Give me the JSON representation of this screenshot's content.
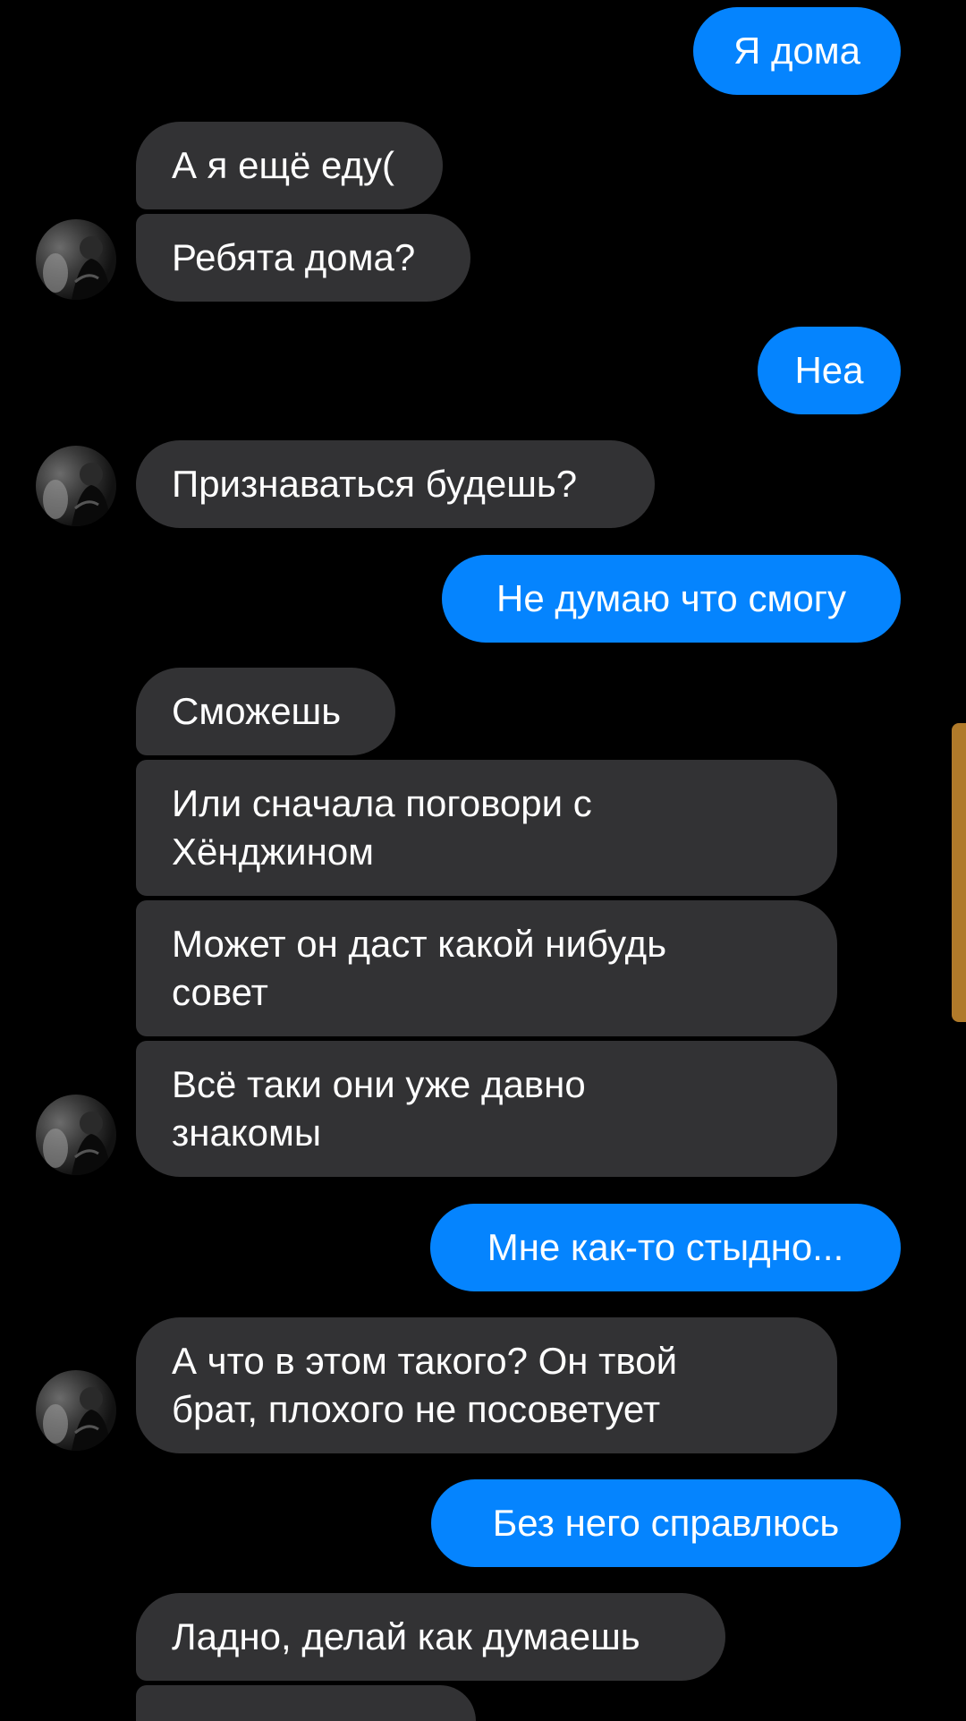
{
  "colors": {
    "background": "#000000",
    "incoming_bubble": "#323234",
    "outgoing_bubble": "#0584fe",
    "text": "#ffffff",
    "scroll_indicator": "#b07a2a"
  },
  "avatar_icon": "contact-photo",
  "messages": [
    {
      "direction": "out",
      "text": "Я дома"
    },
    {
      "direction": "in",
      "text": "А я ещё еду("
    },
    {
      "direction": "in",
      "text": "Ребята дома?"
    },
    {
      "direction": "out",
      "text": "Неа"
    },
    {
      "direction": "in",
      "text": "Признаваться будешь?"
    },
    {
      "direction": "out",
      "text": "Не думаю что смогу"
    },
    {
      "direction": "in",
      "text": "Сможешь"
    },
    {
      "direction": "in",
      "text": "Или сначала поговори с\nХёнджином"
    },
    {
      "direction": "in",
      "text": "Может он даст какой нибудь\nсовет"
    },
    {
      "direction": "in",
      "text": "Всё таки они уже давно\nзнакомы"
    },
    {
      "direction": "out",
      "text": "Мне как-то стыдно..."
    },
    {
      "direction": "in",
      "text": "А что в этом такого? Он твой\nбрат, плохого не посоветует"
    },
    {
      "direction": "out",
      "text": "Без него справлюсь"
    },
    {
      "direction": "in",
      "text": "Ладно, делай как думаешь"
    }
  ]
}
